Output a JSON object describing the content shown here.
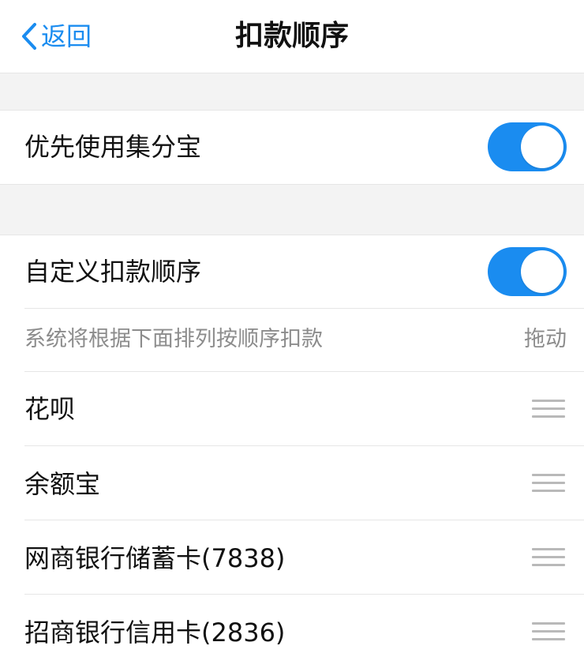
{
  "nav": {
    "back_label": "返回",
    "title": "扣款顺序"
  },
  "jifenbao": {
    "label": "优先使用集分宝",
    "enabled": true
  },
  "custom_order": {
    "label": "自定义扣款顺序",
    "enabled": true,
    "hint": "系统将根据下面排列按顺序扣款",
    "drag_label": "拖动"
  },
  "payment_methods": [
    {
      "label": "花呗"
    },
    {
      "label": "余额宝"
    },
    {
      "label": "网商银行储蓄卡(7838)"
    },
    {
      "label": "招商银行信用卡(2836)"
    }
  ],
  "colors": {
    "accent": "#1a8cf0",
    "background_gap": "#f3f3f3",
    "divider": "#e6e6e6",
    "hint_text": "#8c8c8c"
  }
}
